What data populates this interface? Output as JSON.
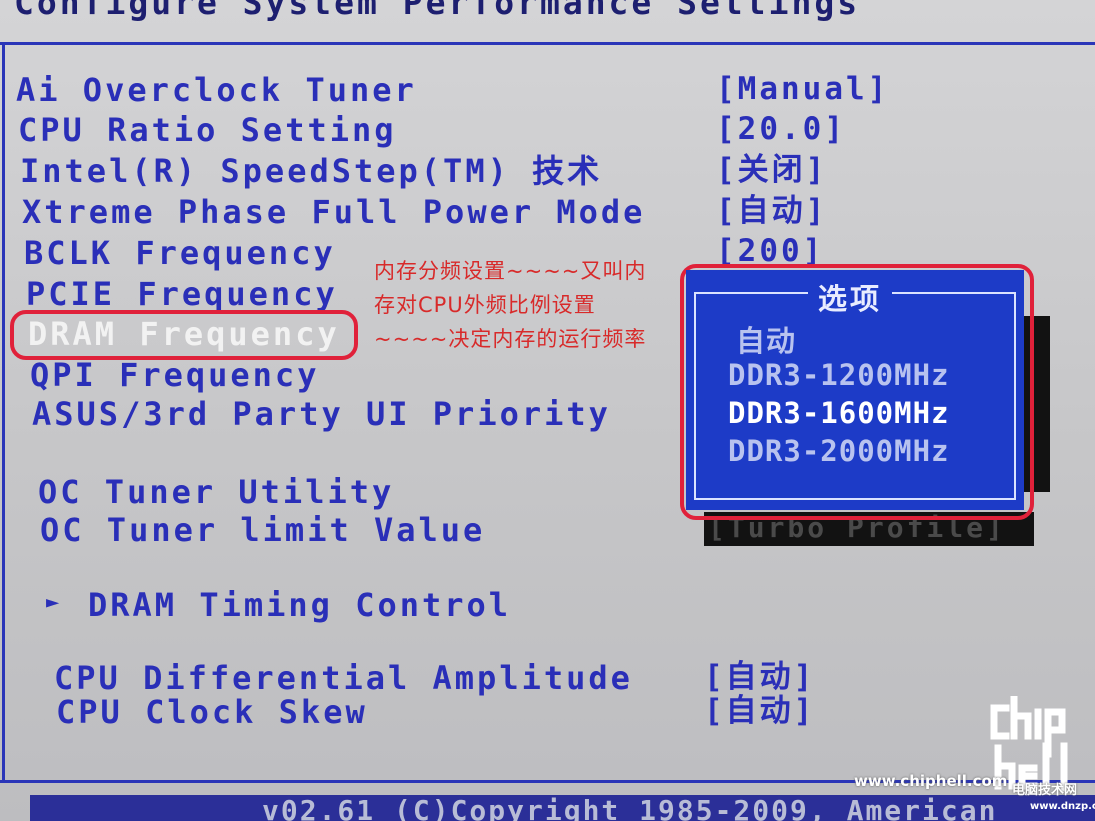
{
  "header": {
    "title": "Configure System Performance Settings"
  },
  "settings": [
    {
      "label": "Ai Overclock Tuner",
      "value": "[Manual]"
    },
    {
      "label": "CPU Ratio Setting",
      "value": "[20.0]"
    },
    {
      "label": "Intel(R) SpeedStep(TM) 技术",
      "value": "[关闭]"
    },
    {
      "label": "Xtreme Phase Full Power Mode",
      "value": "[自动]"
    },
    {
      "label": "BCLK Frequency",
      "value": "[200]"
    },
    {
      "label": "PCIE Frequency",
      "value": ""
    },
    {
      "label": "DRAM Frequency",
      "value": ""
    },
    {
      "label": "QPI Frequency",
      "value": ""
    },
    {
      "label": "ASUS/3rd Party UI Priority",
      "value": ""
    },
    {
      "label": "OC Tuner Utility",
      "value": ""
    },
    {
      "label": "OC Tuner limit Value",
      "value": "[Turbo Profile]"
    },
    {
      "label": "DRAM Timing Control",
      "value": ""
    },
    {
      "label": "CPU Differential Amplitude",
      "value": "[自动]"
    },
    {
      "label": "CPU Clock Skew",
      "value": "[自动]"
    }
  ],
  "submenu_arrow": "►",
  "annotation": {
    "text": "内存分频设置~~~~又叫内存对CPU外频比例设置~~~~决定内存的运行频率"
  },
  "popup": {
    "title": "选项",
    "options": [
      "自动",
      "DDR3-1200MHz",
      "DDR3-1600MHz",
      "DDR3-2000MHz"
    ],
    "selected": "DDR3-1600MHz"
  },
  "footer": {
    "text": "v02.61 (C)Copyright 1985-2009, American"
  },
  "watermark": {
    "logo": "chip hell",
    "url": "www.chiphell.com",
    "site_cn": "电脑技术网",
    "site_url": "www.dnzp.com"
  },
  "colors": {
    "label_blue": "#2a2fb8",
    "highlight_white": "#f2f2f2",
    "popup_bg": "#1d3bc7",
    "annotation_red": "#d82a2a",
    "status_bar": "#2b2f98"
  }
}
